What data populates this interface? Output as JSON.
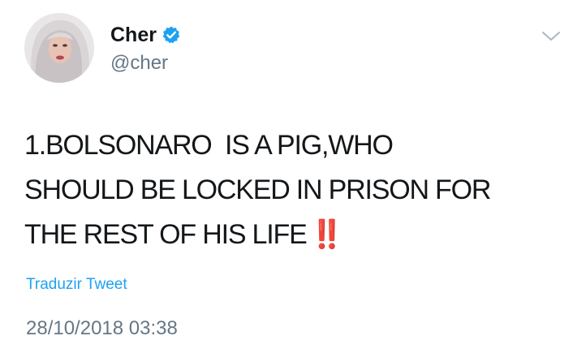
{
  "author": {
    "display_name": "Cher",
    "handle": "@cher",
    "verified": true
  },
  "tweet": {
    "lines": [
      "1.BOLSONARO  IS A PIG,WHO",
      "SHOULD BE LOCKED IN PRISON FOR",
      "THE REST OF HIS LIFE"
    ],
    "emphasis": "‼️"
  },
  "actions": {
    "translate_label": "Traduzir Tweet"
  },
  "meta": {
    "timestamp": "28/10/2018 03:38"
  },
  "colors": {
    "text": "#14171a",
    "secondary": "#657786",
    "link": "#1da1f2",
    "verified": "#1da1f2",
    "emphasis": "#e0192b"
  },
  "icons": {
    "verified": "verified-badge-icon",
    "menu": "chevron-down-icon"
  }
}
